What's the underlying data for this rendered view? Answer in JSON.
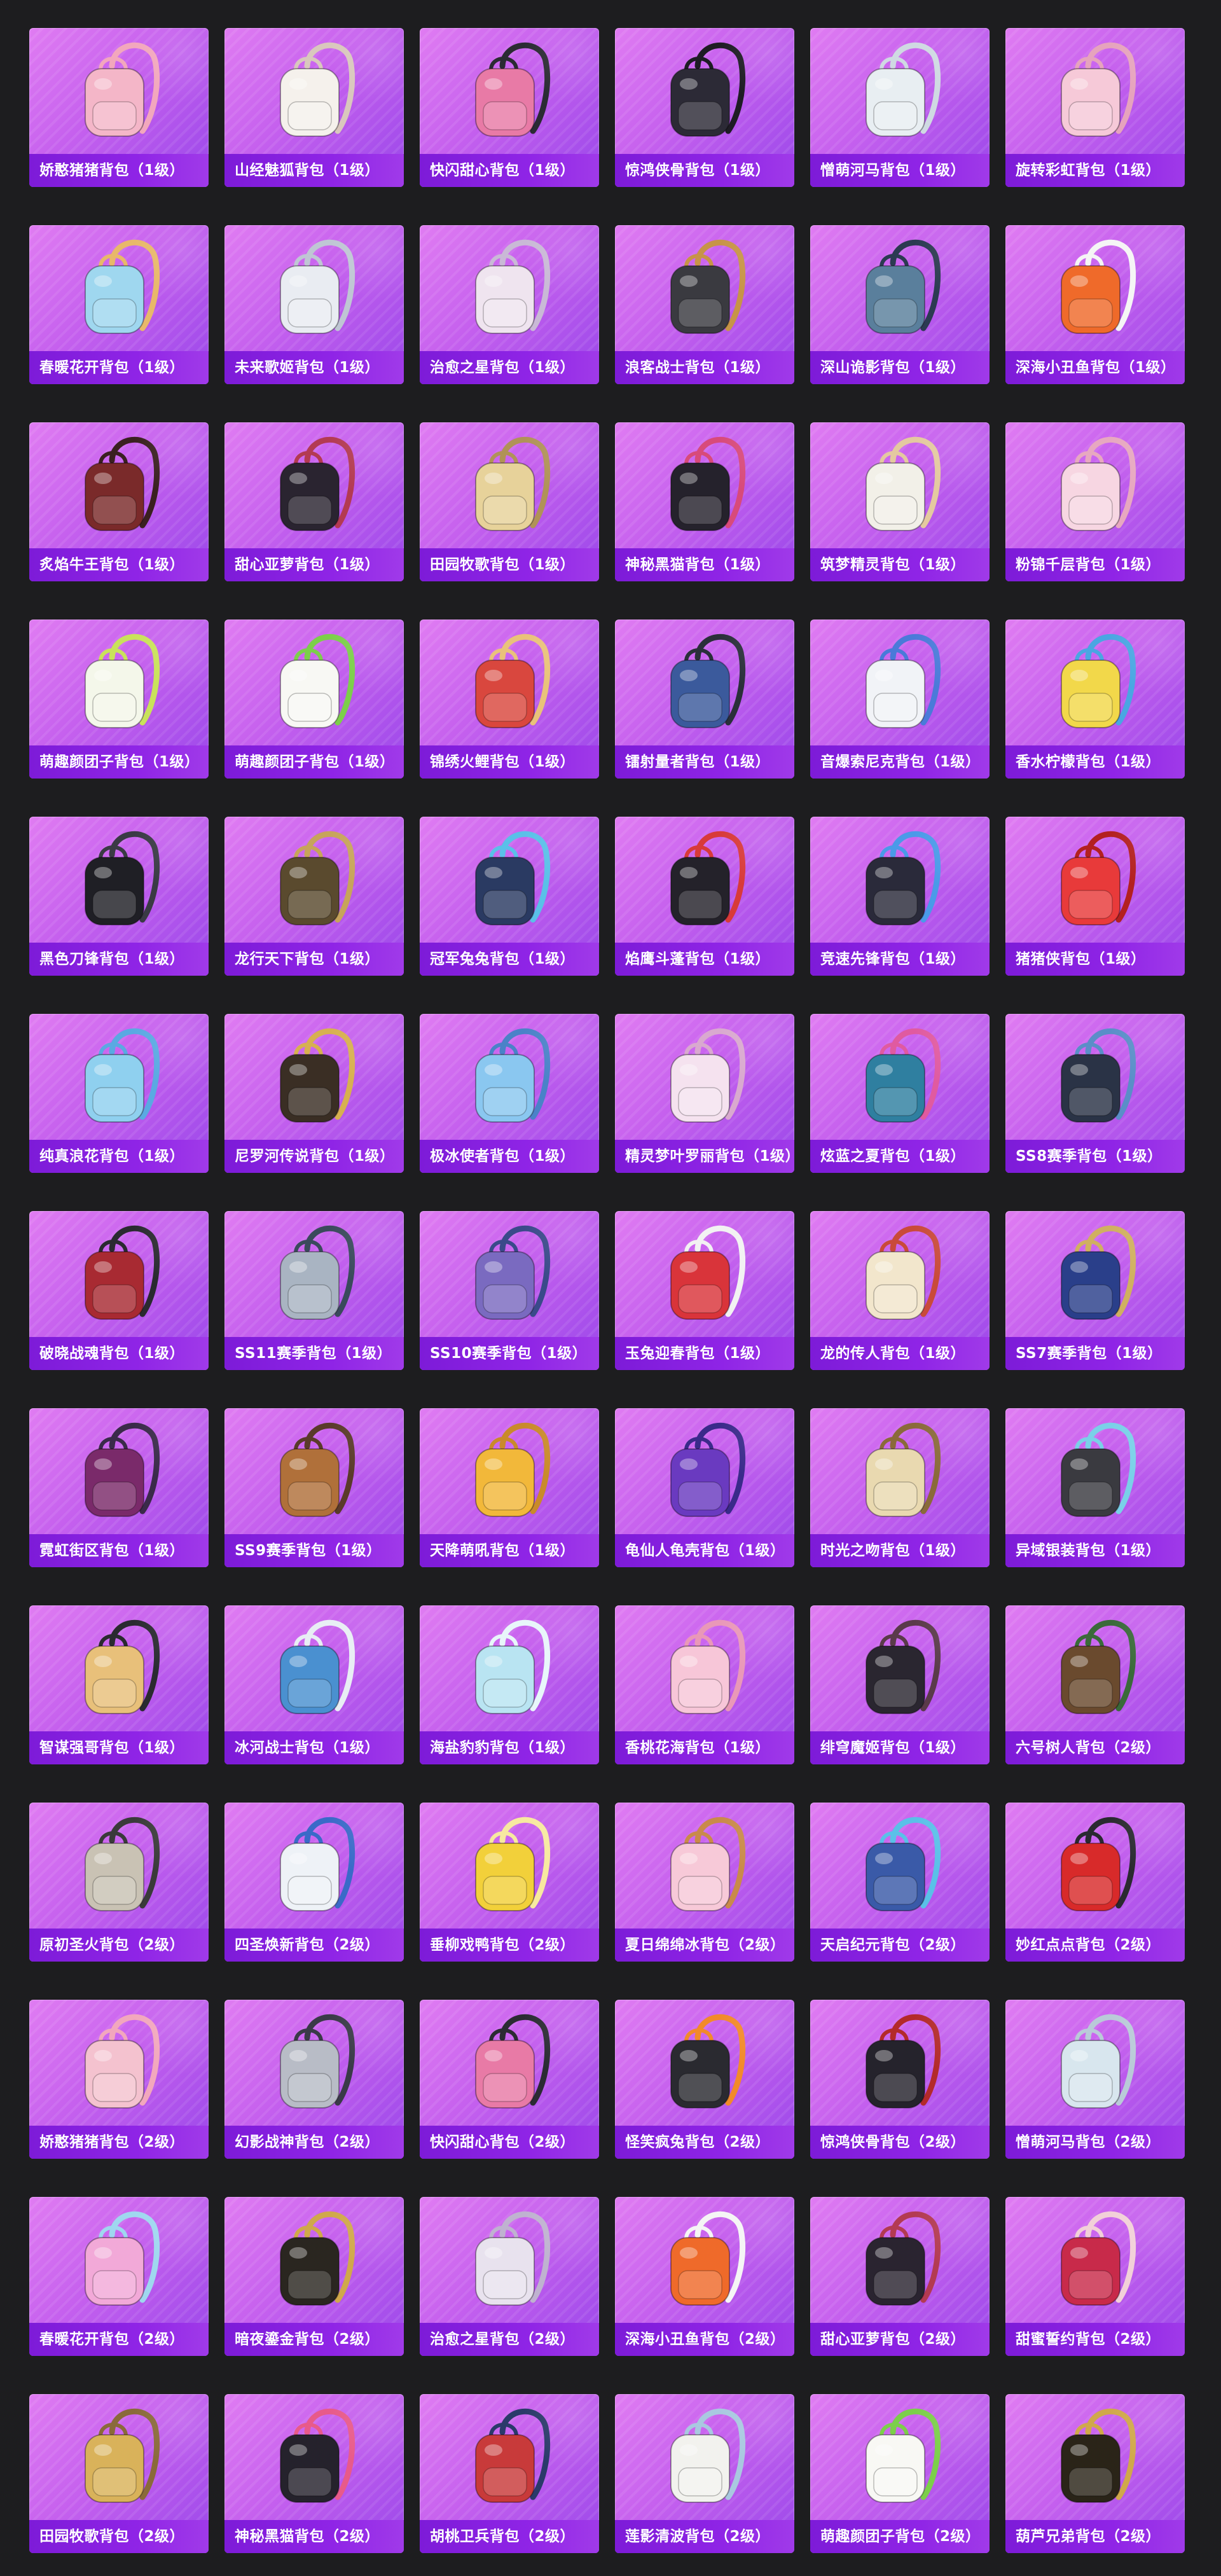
{
  "items": [
    {
      "name": "娇憨猪猪背包（1级）",
      "color": "#f4b6c8",
      "strap": "#f2a7bd"
    },
    {
      "name": "山经魅狐背包（1级）",
      "color": "#f5f1ec",
      "strap": "#d9c7bd"
    },
    {
      "name": "快闪甜心背包（1级）",
      "color": "#e87aa6",
      "strap": "#2b2b33"
    },
    {
      "name": "惊鸿侠骨背包（1级）",
      "color": "#2c2a36",
      "strap": "#1e1c24"
    },
    {
      "name": "憎萌河马背包（1级）",
      "color": "#e8eef2",
      "strap": "#cfd9e2"
    },
    {
      "name": "旋转彩虹背包（1级）",
      "color": "#f6c9d8",
      "strap": "#e6a3bd"
    },
    {
      "name": "春暖花开背包（1级）",
      "color": "#9fd7ef",
      "strap": "#e8b86a"
    },
    {
      "name": "未来歌姬背包（1级）",
      "color": "#e9ecf2",
      "strap": "#bfc6d4"
    },
    {
      "name": "治愈之星背包（1级）",
      "color": "#efe4ef",
      "strap": "#c9b9d6"
    },
    {
      "name": "浪客战士背包（1级）",
      "color": "#3a3a40",
      "strap": "#c79447"
    },
    {
      "name": "深山诡影背包（1级）",
      "color": "#5a7f9c",
      "strap": "#2c3a52"
    },
    {
      "name": "深海小丑鱼背包（1级）",
      "color": "#ef6a2a",
      "strap": "#f5f5f5"
    },
    {
      "name": "炙焰牛王背包（1级）",
      "color": "#7a2a2a",
      "strap": "#3a2020"
    },
    {
      "name": "甜心亚萝背包（1级）",
      "color": "#2a2430",
      "strap": "#b33a52"
    },
    {
      "name": "田园牧歌背包（1级）",
      "color": "#e7d29a",
      "strap": "#b09257"
    },
    {
      "name": "神秘黑猫背包（1级）",
      "color": "#25222c",
      "strap": "#d84a7a"
    },
    {
      "name": "筑梦精灵背包（1级）",
      "color": "#f2f0e8",
      "strap": "#e4c9a0"
    },
    {
      "name": "粉锦千层背包（1级）",
      "color": "#f7d6e2",
      "strap": "#e7a8c0"
    },
    {
      "name": "萌趣颜团子背包（1级）",
      "color": "#f4f7ea",
      "strap": "#c9e25a"
    },
    {
      "name": "萌趣颜团子背包（1级）",
      "color": "#f8f8f4",
      "strap": "#7ccf4a"
    },
    {
      "name": "锦绣火鲤背包（1级）",
      "color": "#d9473e",
      "strap": "#e9c27a"
    },
    {
      "name": "镭射量者背包（1级）",
      "color": "#3b5a9c",
      "strap": "#2a2f3a"
    },
    {
      "name": "音爆索尼克背包（1级）",
      "color": "#f1f3f7",
      "strap": "#4a7ad9"
    },
    {
      "name": "香水柠檬背包（1级）",
      "color": "#f2d84a",
      "strap": "#4aa6e2"
    },
    {
      "name": "黑色刀锋背包（1级）",
      "color": "#1f1f25",
      "strap": "#3a3a44"
    },
    {
      "name": "龙行天下背包（1级）",
      "color": "#5a4a2e",
      "strap": "#c7a45a"
    },
    {
      "name": "冠军兔兔背包（1级）",
      "color": "#2a3a62",
      "strap": "#5ac0e8"
    },
    {
      "name": "焰鹰斗蓬背包（1级）",
      "color": "#24222a",
      "strap": "#d83a3a"
    },
    {
      "name": "竞速先锋背包（1级）",
      "color": "#2a2a3a",
      "strap": "#4a9ae8"
    },
    {
      "name": "猪猪侠背包（1级）",
      "color": "#e83a3a",
      "strap": "#b32020"
    },
    {
      "name": "纯真浪花背包（1级）",
      "color": "#8fd0ef",
      "strap": "#5aa9e2"
    },
    {
      "name": "尼罗河传说背包（1级）",
      "color": "#3a2e24",
      "strap": "#d7b050"
    },
    {
      "name": "极冰使者背包（1级）",
      "color": "#8ac7f0",
      "strap": "#4a82c8"
    },
    {
      "name": "精灵梦叶罗丽背包（1级）",
      "color": "#f5e2ef",
      "strap": "#d9a9cf"
    },
    {
      "name": "炫蓝之夏背包（1级）",
      "color": "#2f7fa0",
      "strap": "#e05aa0"
    },
    {
      "name": "SS8赛季背包（1级）",
      "color": "#2a3346",
      "strap": "#5a8ec8"
    },
    {
      "name": "破晓战魂背包（1级）",
      "color": "#a82a32",
      "strap": "#2a2a30"
    },
    {
      "name": "SS11赛季背包（1级）",
      "color": "#a9b4c2",
      "strap": "#3a4a5c"
    },
    {
      "name": "SS10赛季背包（1级）",
      "color": "#7a6ac0",
      "strap": "#3a4a8a"
    },
    {
      "name": "玉兔迎春背包（1级）",
      "color": "#d9343a",
      "strap": "#f2f2f2"
    },
    {
      "name": "龙的传人背包（1级）",
      "color": "#f2e6cc",
      "strap": "#c94a3a"
    },
    {
      "name": "SS7赛季背包（1级）",
      "color": "#2a3f8a",
      "strap": "#d0b060"
    },
    {
      "name": "霓虹街区背包（1级）",
      "color": "#7a2a6a",
      "strap": "#3a2a4a"
    },
    {
      "name": "SS9赛季背包（1级）",
      "color": "#b0703a",
      "strap": "#5a3a2a"
    },
    {
      "name": "天降萌吼背包（1级）",
      "color": "#f2b83a",
      "strap": "#c98a2a"
    },
    {
      "name": "龟仙人龟壳背包（1级）",
      "color": "#6a3ac0",
      "strap": "#3a2a8a"
    },
    {
      "name": "时光之吻背包（1级）",
      "color": "#e9d9b0",
      "strap": "#8a6a3a"
    },
    {
      "name": "异域银装背包（1级）",
      "color": "#3a3a40",
      "strap": "#7ad0e8"
    },
    {
      "name": "智谋强哥背包（1级）",
      "color": "#e8c07a",
      "strap": "#2a2a30"
    },
    {
      "name": "冰河战士背包（1级）",
      "color": "#4a90d0",
      "strap": "#e8eef4"
    },
    {
      "name": "海盐豹豹背包（1级）",
      "color": "#b9e4f2",
      "strap": "#e8f6fa"
    },
    {
      "name": "香桃花海背包（1级）",
      "color": "#f7c6d8",
      "strap": "#e998b8"
    },
    {
      "name": "绯穹魔姬背包（1级）",
      "color": "#2a2630",
      "strap": "#5a3a4a"
    },
    {
      "name": "六号树人背包（2级）",
      "color": "#6a4a2e",
      "strap": "#3a6a3a"
    },
    {
      "name": "原初圣火背包（2级）",
      "color": "#c9c2b4",
      "strap": "#3a3a3a"
    },
    {
      "name": "四圣焕新背包（2级）",
      "color": "#eef2f7",
      "strap": "#3a6ac8"
    },
    {
      "name": "垂柳戏鸭背包（2级）",
      "color": "#f2d03a",
      "strap": "#f7e9a0"
    },
    {
      "name": "夏日绵绵冰背包（2级）",
      "color": "#f7c9d8",
      "strap": "#c98a4a"
    },
    {
      "name": "天启纪元背包（2级）",
      "color": "#3a5aa8",
      "strap": "#5ac0e8"
    },
    {
      "name": "妙红点点背包（2级）",
      "color": "#d82a2a",
      "strap": "#2a2a30"
    },
    {
      "name": "娇憨猪猪背包（2级）",
      "color": "#f4c2cf",
      "strap": "#f2a7bd"
    },
    {
      "name": "幻影战神背包（2级）",
      "color": "#b8bcc6",
      "strap": "#3a3a48"
    },
    {
      "name": "快闪甜心背包（2级）",
      "color": "#e87aa6",
      "strap": "#2b2b33"
    },
    {
      "name": "怪笑疯兔背包（2级）",
      "color": "#2a2a30",
      "strap": "#f28a2a"
    },
    {
      "name": "惊鸿侠骨背包（2级）",
      "color": "#25232c",
      "strap": "#b32a2a"
    },
    {
      "name": "憎萌河马背包（2级）",
      "color": "#d8e6ee",
      "strap": "#b9cad8"
    },
    {
      "name": "春暖花开背包（2级）",
      "color": "#f2a9d8",
      "strap": "#9fd7ef"
    },
    {
      "name": "暗夜鎏金背包（2级）",
      "color": "#2a2620",
      "strap": "#d0a84a"
    },
    {
      "name": "治愈之星背包（2级）",
      "color": "#e8e2ee",
      "strap": "#bfb2d0"
    },
    {
      "name": "深海小丑鱼背包（2级）",
      "color": "#ef6a2a",
      "strap": "#f5f5f5"
    },
    {
      "name": "甜心亚萝背包（2级）",
      "color": "#2a2430",
      "strap": "#b33a52"
    },
    {
      "name": "甜蜜誓约背包（2级）",
      "color": "#c82a4a",
      "strap": "#f2d0d8"
    },
    {
      "name": "田园牧歌背包（2级）",
      "color": "#d9b25a",
      "strap": "#8a6a3a"
    },
    {
      "name": "神秘黑猫背包（2级）",
      "color": "#25222c",
      "strap": "#e85a8a"
    },
    {
      "name": "胡桃卫兵背包（2级）",
      "color": "#c83a3a",
      "strap": "#2a3a6a"
    },
    {
      "name": "莲影清波背包（2级）",
      "color": "#f2f2ee",
      "strap": "#a9c8e0"
    },
    {
      "name": "萌趣颜团子背包（2级）",
      "color": "#f8f8f4",
      "strap": "#7ccf4a"
    },
    {
      "name": "葫芦兄弟背包（2级）",
      "color": "#2a2418",
      "strap": "#d0a84a"
    }
  ]
}
